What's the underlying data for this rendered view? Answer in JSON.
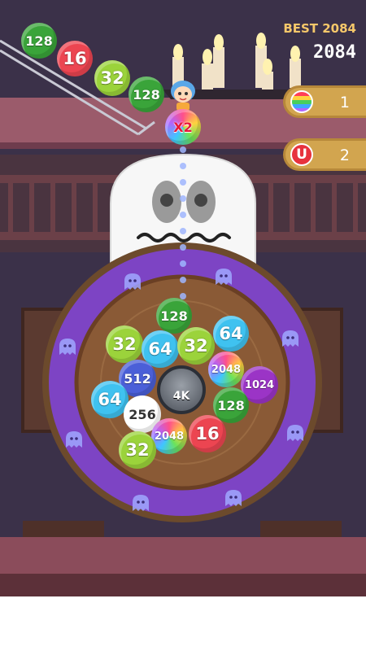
{
  "hud": {
    "best_label": "BEST 2084",
    "score": "2084"
  },
  "powerups": [
    {
      "name": "rainbow-ball",
      "count": "1"
    },
    {
      "name": "magnet",
      "count": "2"
    }
  ],
  "shooter_ball": {
    "label": "X2"
  },
  "center": {
    "label": "4K"
  },
  "colors": {
    "c128": "#3aa43a",
    "c16": "#ec4551",
    "c32": "#9bd33b",
    "c64": "#3fc2f0",
    "c512": "#4b5fd8",
    "c256": "#ffffff",
    "c1024": "#9b34c6",
    "c2048": "#rainbow",
    "ring": "#7d44c4",
    "board": "#8a5a36",
    "floor": "#8b4c5b"
  },
  "queue_balls": [
    {
      "label": "128",
      "color": "#3aa43a"
    },
    {
      "label": "16",
      "color": "#ec4551"
    },
    {
      "label": "32",
      "color": "#9bd33b"
    },
    {
      "label": "128",
      "color": "#3aa43a"
    }
  ],
  "board_balls": [
    {
      "label": "128",
      "color": "#3aa43a"
    },
    {
      "label": "32",
      "color": "#9bd33b"
    },
    {
      "label": "64",
      "color": "#3fc2f0"
    },
    {
      "label": "32",
      "color": "#9bd33b"
    },
    {
      "label": "64",
      "color": "#3fc2f0"
    },
    {
      "label": "512",
      "color": "#4b5fd8"
    },
    {
      "label": "2048",
      "color": "rainbow"
    },
    {
      "label": "1024",
      "color": "#9b34c6"
    },
    {
      "label": "64",
      "color": "#3fc2f0"
    },
    {
      "label": "128",
      "color": "#3aa43a"
    },
    {
      "label": "256",
      "color": "#ffffff"
    },
    {
      "label": "2048",
      "color": "rainbow"
    },
    {
      "label": "16",
      "color": "#ec4551"
    },
    {
      "label": "32",
      "color": "#9bd33b"
    }
  ]
}
